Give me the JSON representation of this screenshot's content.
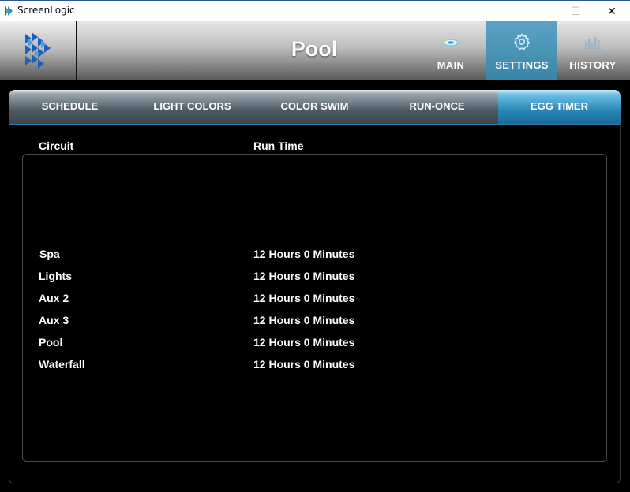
{
  "window": {
    "title": "ScreenLogic",
    "minimize_glyph": "—",
    "maximize_glyph": "☐",
    "close_glyph": "✕"
  },
  "header": {
    "page_title": "Pool",
    "nav": [
      {
        "label": "MAIN",
        "icon": "pool-toy-icon"
      },
      {
        "label": "SETTINGS",
        "icon": "gear-icon",
        "active": true
      },
      {
        "label": "HISTORY",
        "icon": "bar-chart-icon"
      }
    ]
  },
  "subtabs": [
    {
      "label": "SCHEDULE"
    },
    {
      "label": "LIGHT COLORS"
    },
    {
      "label": "COLOR SWIM"
    },
    {
      "label": "RUN-ONCE"
    },
    {
      "label": "EGG TIMER",
      "active": true
    }
  ],
  "table": {
    "headers": {
      "circuit": "Circuit",
      "run_time": "Run Time"
    },
    "rows": [
      {
        "circuit": "Spa",
        "run_time": "12 Hours 0 Minutes"
      },
      {
        "circuit": "Lights",
        "run_time": "12 Hours 0 Minutes"
      },
      {
        "circuit": "Aux 2",
        "run_time": "12 Hours 0 Minutes"
      },
      {
        "circuit": "Aux 3",
        "run_time": "12 Hours 0 Minutes"
      },
      {
        "circuit": "Pool",
        "run_time": "12 Hours 0 Minutes"
      },
      {
        "circuit": "Waterfall",
        "run_time": "12 Hours 0 Minutes"
      }
    ]
  },
  "colors": {
    "accent_active": "#3a86a8",
    "subtab_active": "#2b86b8",
    "background": "#000000",
    "text": "#ffffff"
  }
}
